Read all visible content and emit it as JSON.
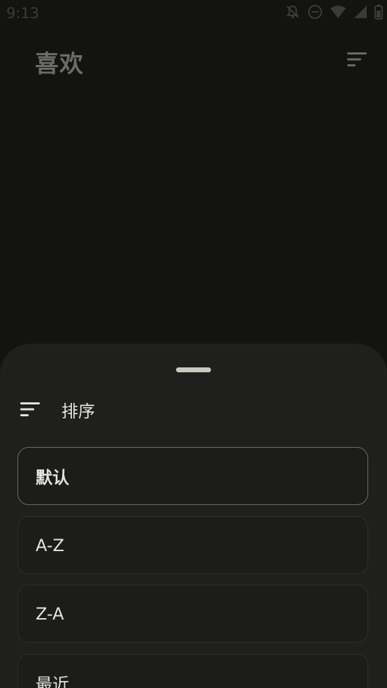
{
  "status_bar": {
    "time": "9:13",
    "icons": [
      "notifications-off-icon",
      "do-not-disturb-icon",
      "wifi-icon",
      "signal-icon",
      "battery-icon"
    ]
  },
  "app_bar": {
    "title": "喜欢",
    "sort_icon": "sort-icon"
  },
  "sort_sheet": {
    "title": "排序",
    "header_icon": "sort-icon",
    "options": [
      {
        "label": "默认",
        "selected": true
      },
      {
        "label": "A-Z",
        "selected": false
      },
      {
        "label": "Z-A",
        "selected": false
      },
      {
        "label": "最近",
        "selected": false
      }
    ]
  },
  "colors": {
    "scrim_background": "#131412",
    "sheet_background": "#1f201d",
    "text_primary": "#e4e5dc",
    "selected_border": "#6a6c65"
  }
}
